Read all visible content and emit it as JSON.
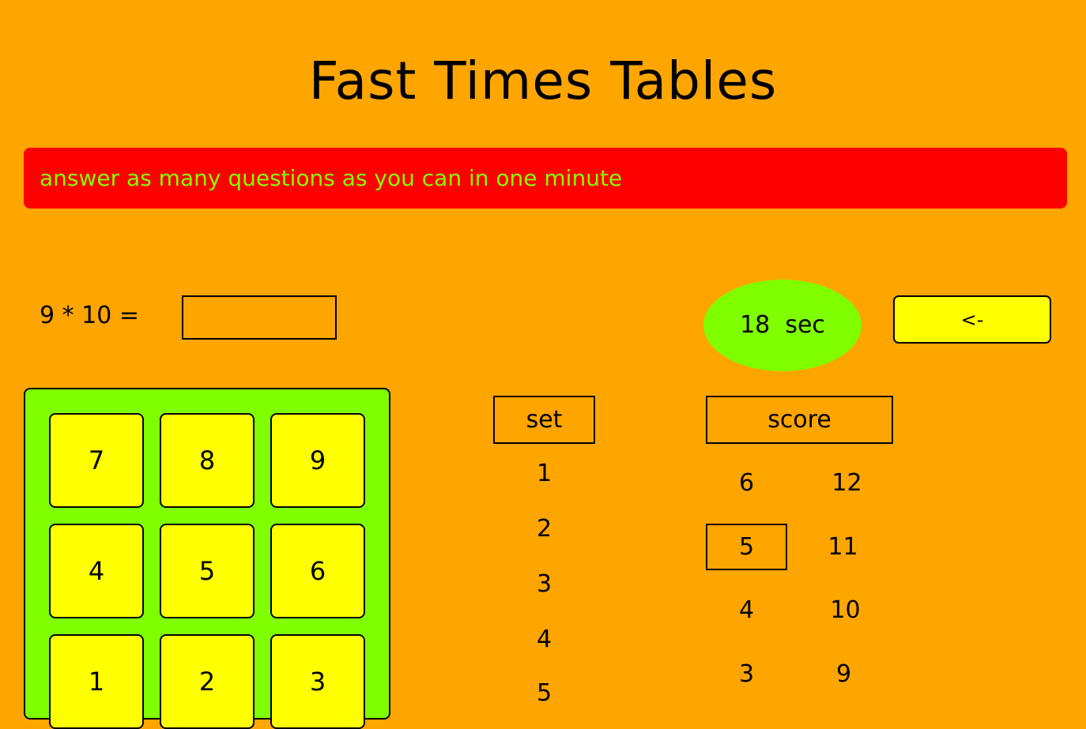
{
  "title": "Fast Times Tables",
  "banner": {
    "text": "answer as many questions as you can in one minute"
  },
  "question": {
    "text": "9 * 10 ="
  },
  "answer": {
    "value": "",
    "placeholder": ""
  },
  "timer": {
    "value": "18",
    "unit": "sec",
    "display": "18  sec"
  },
  "backspace": {
    "label": "<-"
  },
  "keypad": {
    "keys": [
      "7",
      "8",
      "9",
      "4",
      "5",
      "6",
      "1",
      "2",
      "3"
    ]
  },
  "sets": {
    "header": "set",
    "items": [
      "1",
      "2",
      "3",
      "4",
      "5"
    ]
  },
  "scores": {
    "header": "score",
    "left_column": [
      "6",
      "5",
      "4",
      "3"
    ],
    "right_column": [
      "12",
      "11",
      "10",
      "9"
    ],
    "selected": "5"
  },
  "colors": {
    "background": "#ffa500",
    "banner": "#ff0000",
    "banner_text": "#7fff00",
    "timer": "#7fff00",
    "keypad_panel": "#7fff00",
    "keys": "#ffff00",
    "backspace": "#ffff00"
  }
}
